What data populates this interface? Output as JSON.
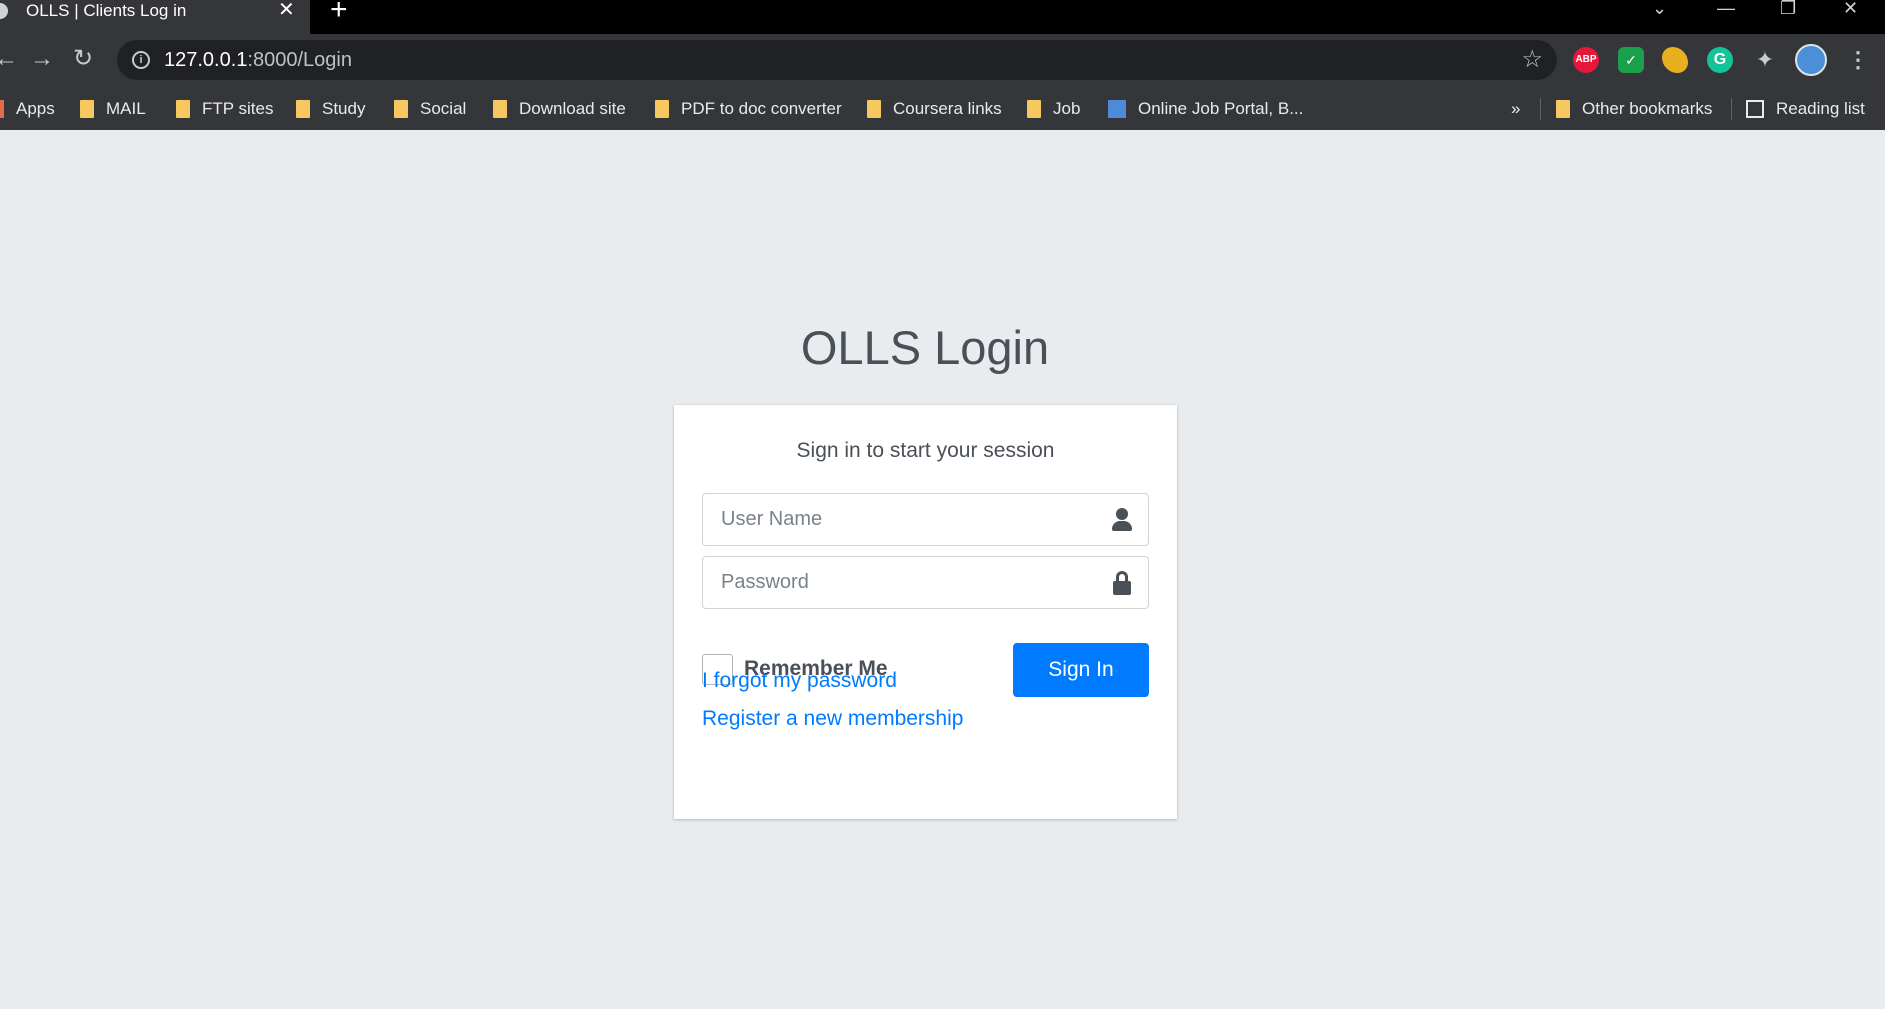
{
  "browser": {
    "tab_title": "OLLS | Clients Log in",
    "tab_close": "✕",
    "new_tab": "+",
    "window_controls": {
      "dropdown": "⌄",
      "minimize": "—",
      "restore": "❐",
      "close": "✕"
    },
    "nav": {
      "back": "←",
      "forward": "→",
      "reload": "↻"
    },
    "url_host": "127.0.0.1",
    "url_rest": ":8000/Login",
    "star": "☆",
    "extensions": {
      "abp": "ABP",
      "shield": "✓",
      "grammarly": "G",
      "puzzle": "✦",
      "menu": "⋮"
    }
  },
  "bookmarks": {
    "items": [
      "Apps",
      "MAIL",
      "FTP sites",
      "Study",
      "Social",
      "Download site",
      "PDF to doc converter",
      "Coursera links",
      "Job",
      "Online Job Portal, B..."
    ],
    "overflow": "»",
    "other": "Other bookmarks",
    "reading_list": "Reading list"
  },
  "login": {
    "logo_bold": "OLLS",
    "logo_light": " Login",
    "message": "Sign in to start your session",
    "username_placeholder": "User Name",
    "password_placeholder": "Password",
    "remember_label": "Remember Me",
    "signin_label": "Sign In",
    "forgot_link": "I forgot my password",
    "register_link": "Register a new membership"
  },
  "colors": {
    "page_bg": "#e9ecef",
    "primary": "#007bff",
    "chrome_dark": "#35363a"
  }
}
